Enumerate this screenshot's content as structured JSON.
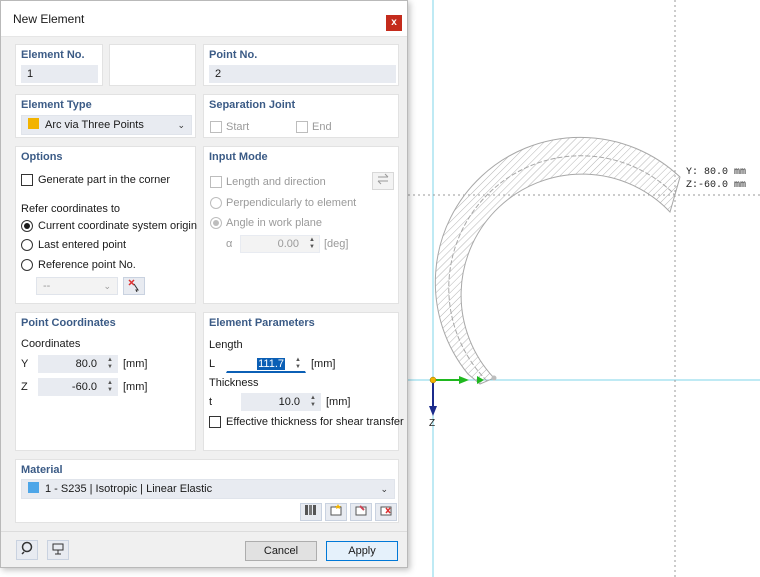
{
  "canvas": {
    "coord_y": "Y: 80.0 mm",
    "coord_z": "Z:-60.0 mm",
    "axis_z_label": "Z",
    "colors": {
      "guide": "#7fd6ea",
      "axis_y": "#1fb81f",
      "axis_z": "#1b2b8c",
      "origin": "#f2b300"
    }
  },
  "dialog": {
    "title": "New Element",
    "close_icon": "close-icon",
    "element_no": {
      "label": "Element No.",
      "value": "1"
    },
    "point_no": {
      "label": "Point No.",
      "value": "2"
    },
    "element_type": {
      "label": "Element Type",
      "value": "Arc via Three Points",
      "swatch_color": "#f2b300"
    },
    "separation_joint": {
      "label": "Separation Joint",
      "start": "Start",
      "end": "End"
    },
    "options": {
      "label": "Options",
      "generate_part": "Generate part in the corner",
      "refer_label": "Refer coordinates to",
      "radio_origin": "Current coordinate system origin",
      "radio_last": "Last entered point",
      "radio_ref": "Reference point No.",
      "ref_value": "--"
    },
    "input_mode": {
      "label": "Input Mode",
      "length_direction": "Length and direction",
      "perpendicular": "Perpendicularly to element",
      "angle_work_plane": "Angle in work plane",
      "alpha_symbol": "α",
      "alpha_value": "0.00",
      "alpha_unit": "[deg]"
    },
    "point_coordinates": {
      "label": "Point Coordinates",
      "coords_label": "Coordinates",
      "y_label": "Y",
      "y_value": "80.0",
      "y_unit": "[mm]",
      "z_label": "Z",
      "z_value": "-60.0",
      "z_unit": "[mm]"
    },
    "element_parameters": {
      "label": "Element Parameters",
      "length_label": "Length",
      "l_symbol": "L",
      "l_value": "111.7",
      "l_unit": "[mm]",
      "thickness_label": "Thickness",
      "t_symbol": "t",
      "t_value": "10.0",
      "t_unit": "[mm]",
      "effective_thickness": "Effective thickness for shear transfer"
    },
    "material": {
      "label": "Material",
      "value": "1 - S235 | Isotropic | Linear Elastic",
      "swatch_color": "#4da6e8"
    },
    "buttons": {
      "cancel": "Cancel",
      "apply": "Apply"
    }
  }
}
